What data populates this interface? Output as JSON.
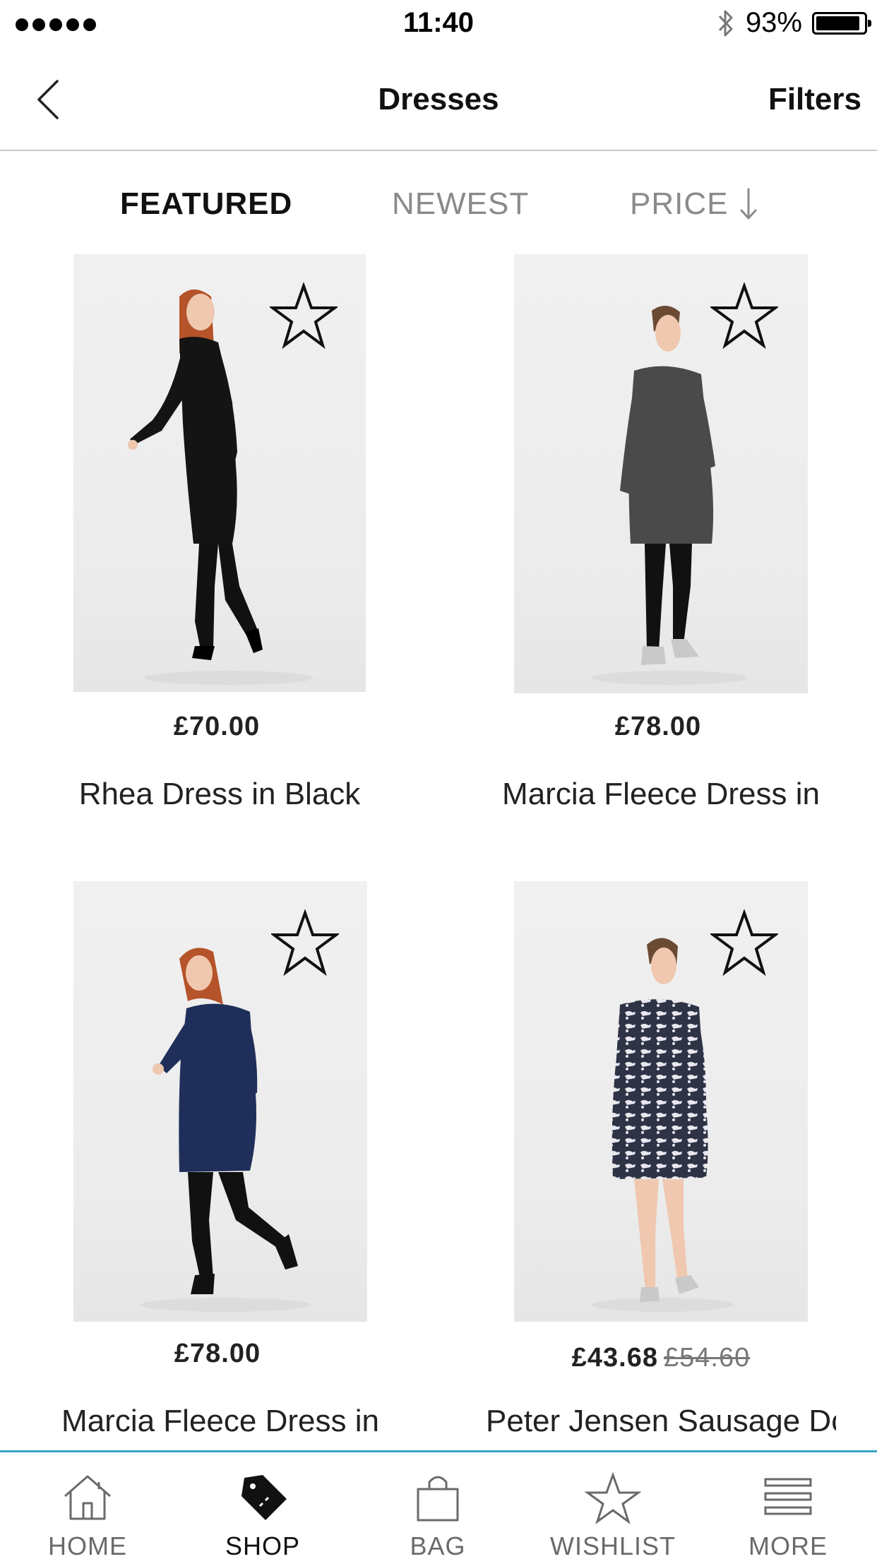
{
  "status_bar": {
    "time": "11:40",
    "battery_percent": "93%",
    "battery_level": 0.93,
    "signal_bars": 5,
    "bluetooth_icon": "bluetooth-icon"
  },
  "nav": {
    "back_icon": "chevron-left-icon",
    "title": "Dresses",
    "filters_label": "Filters"
  },
  "sort_tabs": [
    {
      "label": "FEATURED",
      "active": true
    },
    {
      "label": "NEWEST",
      "active": false
    },
    {
      "label": "PRICE",
      "active": false,
      "icon": "arrow-down-icon"
    }
  ],
  "products": [
    {
      "price": "£70.00",
      "was_price": "",
      "name": "Rhea Dress in Black",
      "dress_color": "#141414",
      "hair_color": "#b5532a",
      "wishlist_icon": "star-outline-icon"
    },
    {
      "price": "£78.00",
      "was_price": "",
      "name": "Marcia Fleece Dress in",
      "dress_color": "#4a4a4a",
      "hair_color": "#6b4a33",
      "wishlist_icon": "star-outline-icon"
    },
    {
      "price": "£78.00",
      "was_price": "",
      "name": "Marcia Fleece Dress in",
      "dress_color": "#1f2f5a",
      "hair_color": "#b5532a",
      "wishlist_icon": "star-outline-icon"
    },
    {
      "price": "£43.68",
      "was_price": "£54.60",
      "name": "Peter Jensen Sausage Dog",
      "dress_color": "#3a3f52",
      "hair_color": "#6b4a33",
      "wishlist_icon": "star-outline-icon"
    }
  ],
  "tab_bar": {
    "accent_color": "#35a3c8",
    "items": [
      {
        "label": "HOME",
        "icon": "home-icon",
        "active": false
      },
      {
        "label": "SHOP",
        "icon": "tag-icon",
        "active": true
      },
      {
        "label": "BAG",
        "icon": "bag-icon",
        "active": false
      },
      {
        "label": "WISHLIST",
        "icon": "star-icon",
        "active": false
      },
      {
        "label": "MORE",
        "icon": "menu-icon",
        "active": false
      }
    ]
  }
}
